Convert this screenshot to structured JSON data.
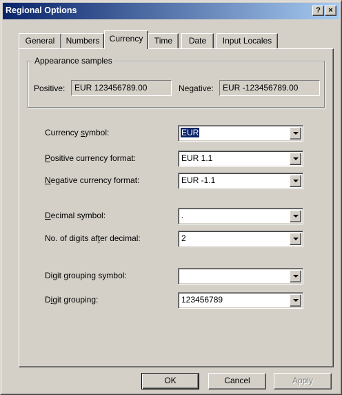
{
  "window": {
    "title": "Regional Options",
    "help_glyph": "?",
    "close_glyph": "×"
  },
  "tabs": [
    {
      "label": "General"
    },
    {
      "label": "Numbers"
    },
    {
      "label": "Currency",
      "active": true
    },
    {
      "label": "Time"
    },
    {
      "label": "Date"
    },
    {
      "label": "Input Locales"
    }
  ],
  "appearance": {
    "group_label": "Appearance samples",
    "positive_label": "Positive:",
    "positive_value": "EUR 123456789.00",
    "negative_label": "Negative:",
    "negative_value": "EUR -123456789.00"
  },
  "fields": {
    "currency_symbol": {
      "label_pre": "Currency ",
      "label_u": "s",
      "label_post": "ymbol:",
      "value": "EUR"
    },
    "positive_format": {
      "label_pre": "",
      "label_u": "P",
      "label_post": "ositive currency format:",
      "value": "EUR 1.1"
    },
    "negative_format": {
      "label_pre": "",
      "label_u": "N",
      "label_post": "egative currency format:",
      "value": "EUR -1.1"
    },
    "decimal_symbol": {
      "label_pre": "",
      "label_u": "D",
      "label_post": "ecimal symbol:",
      "value": "."
    },
    "digits_after_decimal": {
      "label_pre": "No. of digits af",
      "label_u": "t",
      "label_post": "er decimal:",
      "value": "2"
    },
    "grouping_symbol": {
      "label_pre": "Digit ",
      "label_u": "g",
      "label_post": "rouping symbol:",
      "value": ""
    },
    "digit_grouping": {
      "label_pre": "D",
      "label_u": "i",
      "label_post": "git grouping:",
      "value": "123456789"
    }
  },
  "buttons": {
    "ok": "OK",
    "cancel": "Cancel",
    "apply": "Apply"
  }
}
